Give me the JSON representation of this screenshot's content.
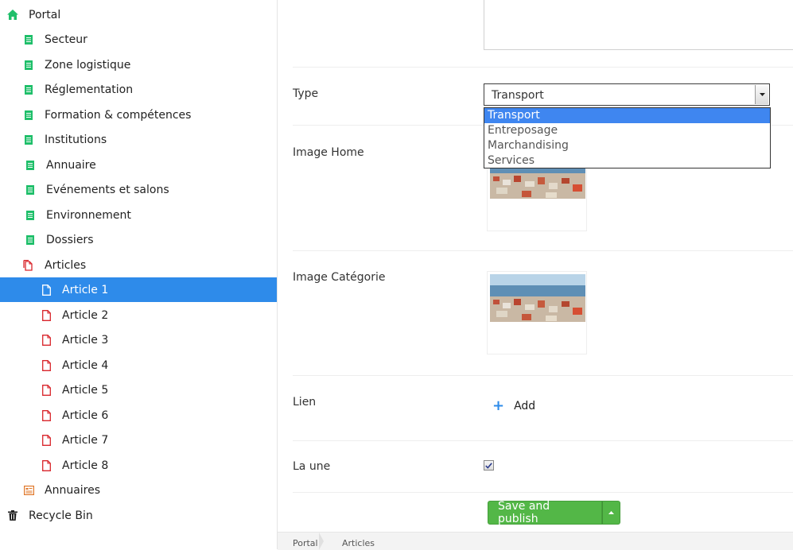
{
  "colors": {
    "accent": "#2e8bea",
    "doc_green": "#1fbf6a",
    "doc_red": "#d9252b",
    "save_green": "#53b747"
  },
  "tree": {
    "root": {
      "label": "Portal",
      "icon": "home-icon"
    },
    "items": [
      {
        "label": "Secteur",
        "icon": "document-list-icon"
      },
      {
        "label": "Zone logistique",
        "icon": "document-list-icon"
      },
      {
        "label": "Réglementation",
        "icon": "document-list-icon"
      },
      {
        "label": "Formation & compétences",
        "icon": "document-list-icon"
      },
      {
        "label": "Institutions",
        "icon": "document-list-icon"
      },
      {
        "label": "Annuaire",
        "icon": "document-list-icon"
      },
      {
        "label": "Evénements et salons",
        "icon": "document-list-icon"
      },
      {
        "label": "Environnement",
        "icon": "document-list-icon"
      },
      {
        "label": "Dossiers",
        "icon": "document-list-icon"
      },
      {
        "label": "Articles",
        "icon": "documents-icon"
      }
    ],
    "articles": [
      {
        "label": "Article 1",
        "selected": true
      },
      {
        "label": "Article 2"
      },
      {
        "label": "Article 3"
      },
      {
        "label": "Article 4"
      },
      {
        "label": "Article 5"
      },
      {
        "label": "Article 6"
      },
      {
        "label": "Article 7"
      },
      {
        "label": "Article 8"
      }
    ],
    "annuaires": {
      "label": "Annuaires",
      "icon": "directory-icon"
    },
    "recycle": {
      "label": "Recycle Bin",
      "icon": "trash-icon"
    }
  },
  "form": {
    "type_label": "Type",
    "type_value": "Transport",
    "type_options": [
      "Transport",
      "Entreposage",
      "Marchandising",
      "Services"
    ],
    "image_home_label": "Image Home",
    "image_categorie_label": "Image Catégorie",
    "lien_label": "Lien",
    "add_label": "Add",
    "la_une_label": "La une",
    "la_une_checked": true,
    "save_label": "Save and publish"
  },
  "breadcrumb": [
    "Portal",
    "Articles"
  ]
}
